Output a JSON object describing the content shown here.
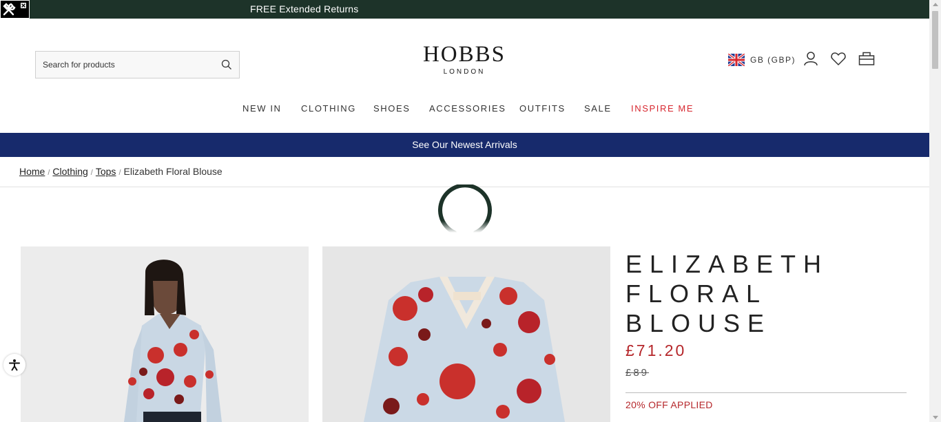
{
  "topbar": {
    "promo": "FREE Extended Returns"
  },
  "search": {
    "placeholder": "Search for products"
  },
  "logo": {
    "name": "HOBBS",
    "subtitle": "LONDON"
  },
  "header": {
    "region": "GB (GBP)"
  },
  "nav": {
    "items": [
      "NEW IN",
      "CLOTHING",
      "SHOES",
      "ACCESSORIES",
      "OUTFITS",
      "SALE",
      "INSPIRE ME"
    ]
  },
  "banner": {
    "text": "See Our Newest Arrivals"
  },
  "breadcrumb": {
    "items": [
      "Home",
      "Clothing",
      "Tops"
    ],
    "current": "Elizabeth Floral Blouse",
    "separator": "/"
  },
  "product": {
    "title_lines": [
      "ELIZABETH",
      "FLORAL",
      "BLOUSE"
    ],
    "price_now": "£71.20",
    "price_was": "£89",
    "discount": "20% OFF APPLIED"
  },
  "colors": {
    "topbar": "#1d3329",
    "banner": "#172a6c",
    "sale_red": "#b5262a",
    "nav_red": "#d7262e"
  },
  "icons": [
    "tools-icon",
    "close-icon",
    "search-icon",
    "uk-flag-icon",
    "account-icon",
    "wishlist-icon",
    "bag-icon",
    "loading-spinner-icon",
    "accessibility-icon"
  ]
}
